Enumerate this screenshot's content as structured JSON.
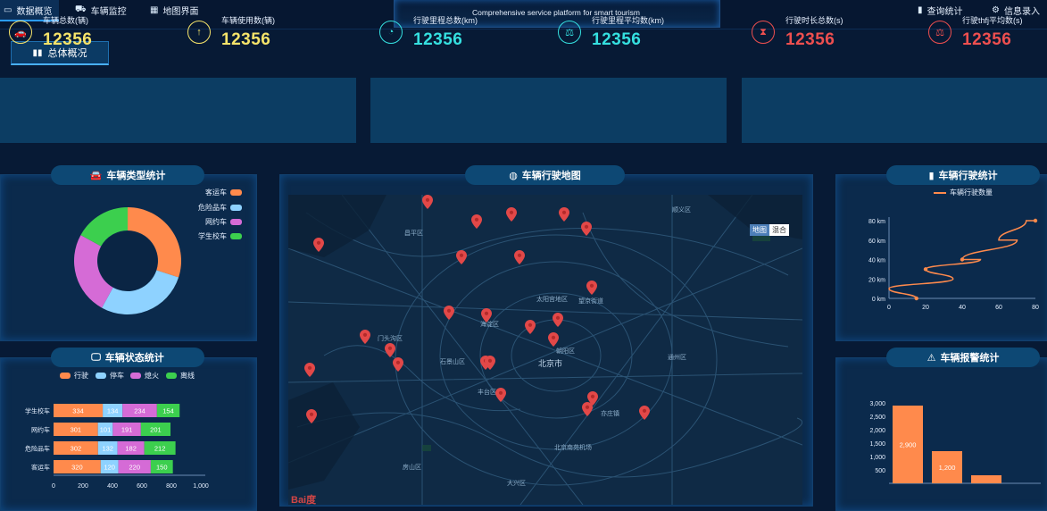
{
  "nav": {
    "left": [
      {
        "label": "数据概览",
        "icon": "monitor-icon",
        "active": true
      },
      {
        "label": "车辆监控",
        "icon": "truck-icon",
        "active": false
      },
      {
        "label": "地图界面",
        "icon": "building-icon",
        "active": false
      }
    ],
    "right": [
      {
        "label": "查询统计",
        "icon": "bar-chart-icon"
      },
      {
        "label": "信息录入",
        "icon": "gear-icon"
      }
    ],
    "subtitle": "Comprehensive service platform for smart tourism"
  },
  "overview": {
    "label": "总体概况",
    "icon": "bar-chart-icon"
  },
  "stats": [
    {
      "label": "车辆总数(辆)",
      "value": "12356",
      "icon": "car-icon",
      "color": "#f6e46a"
    },
    {
      "label": "车辆使用数(辆)",
      "value": "12356",
      "icon": "upload-icon",
      "color": "#f6e46a"
    },
    {
      "label": "行驶里程总数(km)",
      "value": "12356",
      "icon": "dial-icon",
      "color": "#35e0e0"
    },
    {
      "label": "行驶里程平均数(km)",
      "value": "12356",
      "icon": "scale-icon",
      "color": "#35e0e0"
    },
    {
      "label": "行驶时长总数(s)",
      "value": "12356",
      "icon": "hourglass-icon",
      "color": "#ee4f4f"
    },
    {
      "label": "行驶thfj平均数(s)",
      "value": "12356",
      "icon": "scale-icon",
      "color": "#ee4f4f"
    }
  ],
  "panels": {
    "vehicle_type": "车辆类型统计",
    "vehicle_status": "车辆状态统计",
    "map": "车辆行驶地图",
    "travel": "车辆行驶统计",
    "alarm": "车辆报警统计"
  },
  "map": {
    "toggle": [
      "地图",
      "混合"
    ],
    "labels": [
      "北京市",
      "海淀区",
      "朝阳区",
      "丰台区",
      "石景山区",
      "门头沟区",
      "大兴区",
      "房山区",
      "顺义区",
      "通州区",
      "昌平区",
      "北京南苑机场",
      "太阳宫地区",
      "望京街道",
      "亦庄镇"
    ],
    "logo": "Bai度"
  },
  "chart_data": [
    {
      "type": "pie",
      "title": "车辆类型统计",
      "categories": [
        "客运车",
        "危险品车",
        "网约车",
        "学生校车"
      ],
      "values": [
        30,
        28,
        25,
        17
      ],
      "colors": [
        "#ff8a4c",
        "#8ed2ff",
        "#d56bd6",
        "#3ccf4e"
      ]
    },
    {
      "type": "bar",
      "orientation": "horizontal",
      "stacked": true,
      "title": "车辆状态统计",
      "categories": [
        "学生校车",
        "网约车",
        "危险品车",
        "客运车"
      ],
      "series": [
        {
          "name": "行驶",
          "values": [
            334,
            301,
            302,
            320
          ],
          "color": "#ff8a4c"
        },
        {
          "name": "停车",
          "values": [
            134,
            101,
            132,
            120
          ],
          "color": "#8ed2ff"
        },
        {
          "name": "熄火",
          "values": [
            234,
            191,
            182,
            220
          ],
          "color": "#d56bd6"
        },
        {
          "name": "离线",
          "values": [
            154,
            201,
            212,
            150
          ],
          "color": "#3ccf4e"
        }
      ],
      "xlim": [
        0,
        1000
      ],
      "xticks": [
        "0",
        "200",
        "400",
        "600",
        "800",
        "1,000"
      ]
    },
    {
      "type": "line",
      "title": "车辆行驶统计",
      "series": [
        {
          "name": "车辆行驶数量",
          "color": "#ff8a4c",
          "x": [
            15,
            0,
            35,
            20,
            50,
            40,
            70,
            60,
            75,
            80
          ],
          "y": [
            0,
            10,
            20,
            30,
            40,
            40,
            60,
            60,
            80,
            80
          ]
        }
      ],
      "xlim": [
        0,
        80
      ],
      "ylim": [
        0,
        80
      ],
      "xticks": [
        "0",
        "20",
        "40",
        "60",
        "80"
      ],
      "yticks": [
        "0 km",
        "20 km",
        "40 km",
        "60 km",
        "80 km"
      ]
    },
    {
      "type": "bar",
      "title": "车辆报警统计",
      "values": [
        2900,
        1200,
        300
      ],
      "labels": [
        "2,900",
        "1,200",
        ""
      ],
      "ylim": [
        0,
        3000
      ],
      "yticks": [
        "500",
        "1,000",
        "1,500",
        "2,000",
        "2,500",
        "3,000"
      ],
      "color": "#ff8a4c"
    }
  ]
}
